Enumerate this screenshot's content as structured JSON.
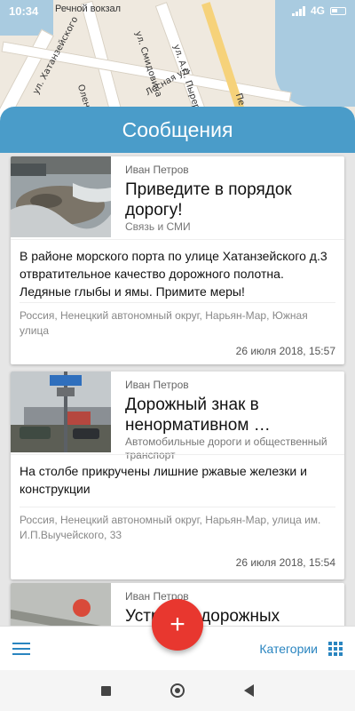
{
  "status_bar": {
    "time": "10:34",
    "map_label": "Речной вокзал",
    "network": "4G"
  },
  "map": {
    "streets": [
      "ул. Хатанзейского",
      "ул. Смидовича",
      "ул. А.П. Пырерки",
      "Оленная",
      "Лесная ул.",
      "Пе"
    ]
  },
  "header": {
    "title": "Сообщения"
  },
  "messages": [
    {
      "author": "Иван Петров",
      "title": "Приведите в порядок дорогу!",
      "category": "Связь и СМИ",
      "text": "В районе морского порта по улице Хатанзейского д.3 отвратительное качество дорожного полотна. Ледяные глыбы и ямы. Примите меры!",
      "address": "Россия, Ненецкий автономный округ, Нарьян-Мар, Южная улица",
      "date": "26 июля 2018, 15:57"
    },
    {
      "author": "Иван Петров",
      "title": "Дорожный знак в ненормативном …",
      "category": "Автомобильные дороги и общественный транспорт",
      "text": "На столбе прикручены лишние ржавые железки и конструкции",
      "address": "Россия, Ненецкий автономный округ, Нарьян-Мар, улица им. И.П.Выучейского, 33",
      "date": "26 июля 2018, 15:54"
    },
    {
      "author": "Иван Петров",
      "title": "Устранка дорожных"
    }
  ],
  "bottom_bar": {
    "categories_label": "Категории",
    "fab_label": "+"
  },
  "icons": {
    "menu": "hamburger-icon",
    "categories": "grid-icon",
    "add": "plus-icon"
  },
  "colors": {
    "header": "#4a9cc9",
    "accent": "#2a85c0",
    "fab": "#e8372f"
  }
}
